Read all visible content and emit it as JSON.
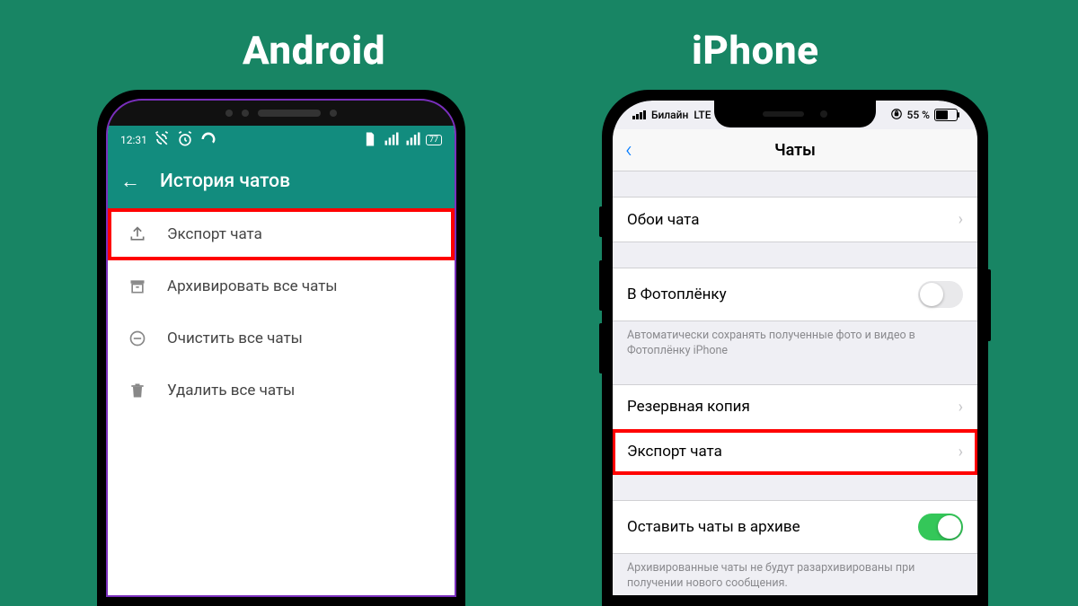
{
  "titles": {
    "android": "Android",
    "iphone": "iPhone"
  },
  "android": {
    "status": {
      "time": "12:31",
      "battery_text": "77"
    },
    "header": {
      "title": "История чатов"
    },
    "items": [
      {
        "icon": "upload-icon",
        "label": "Экспорт чата",
        "highlight": true
      },
      {
        "icon": "archive-icon",
        "label": "Архивировать все чаты",
        "highlight": false
      },
      {
        "icon": "clear-icon",
        "label": "Очистить все чаты",
        "highlight": false
      },
      {
        "icon": "trash-icon",
        "label": "Удалить все чаты",
        "highlight": false
      }
    ]
  },
  "iphone": {
    "status": {
      "carrier": "Билайн",
      "network": "LTE",
      "battery_text": "55 %"
    },
    "nav": {
      "title": "Чаты"
    },
    "group0": {
      "items": [
        {
          "label": "Обои чата"
        }
      ]
    },
    "group1": {
      "items": [
        {
          "label": "В Фотоплёнку",
          "toggle": "off"
        }
      ],
      "footer": "Автоматически сохранять полученные фото и видео в Фотоплёнку iPhone"
    },
    "group2": {
      "items": [
        {
          "label": "Резервная копия",
          "highlight": false
        },
        {
          "label": "Экспорт чата",
          "highlight": true
        }
      ]
    },
    "group3": {
      "items": [
        {
          "label": "Оставить чаты в архиве",
          "toggle": "on"
        }
      ],
      "footer": "Архивированные чаты не будут разархивированы при получении нового сообщения."
    }
  }
}
